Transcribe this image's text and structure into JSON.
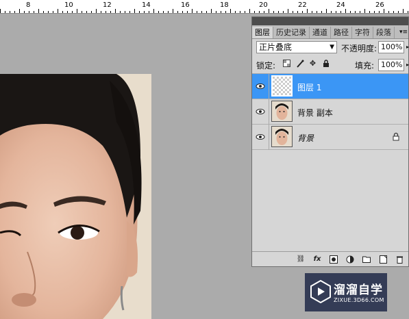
{
  "ruler": {
    "labels": [
      "8",
      "10",
      "12",
      "14",
      "16",
      "18",
      "20",
      "22",
      "24",
      "26"
    ]
  },
  "layers_panel": {
    "tabs": [
      {
        "label": "图层",
        "active": true
      },
      {
        "label": "历史记录",
        "active": false
      },
      {
        "label": "通道",
        "active": false
      },
      {
        "label": "路径",
        "active": false
      },
      {
        "label": "字符",
        "active": false
      },
      {
        "label": "段落",
        "active": false
      }
    ],
    "blend_mode": "正片叠底",
    "opacity_label": "不透明度:",
    "opacity_value": "100%",
    "lock_label": "锁定:",
    "fill_label": "填充:",
    "fill_value": "100%",
    "layers": [
      {
        "name": "图层 1",
        "selected": true,
        "thumb": "transparent"
      },
      {
        "name": "背景 副本",
        "selected": false,
        "thumb": "face"
      },
      {
        "name": "背景",
        "selected": false,
        "thumb": "face",
        "locked": true
      }
    ],
    "footer_icons": [
      "link-icon",
      "fx-icon",
      "mask-icon",
      "adjustment-icon",
      "group-folder-icon",
      "new-layer-icon",
      "trash-icon"
    ]
  },
  "watermark": {
    "title": "溜溜自学",
    "subtitle": "ZIXUE.3D66.COM"
  },
  "colors": {
    "canvas_bg": "#ababab",
    "panel_bg": "#d6d6d6",
    "selection": "#3b96f5"
  }
}
